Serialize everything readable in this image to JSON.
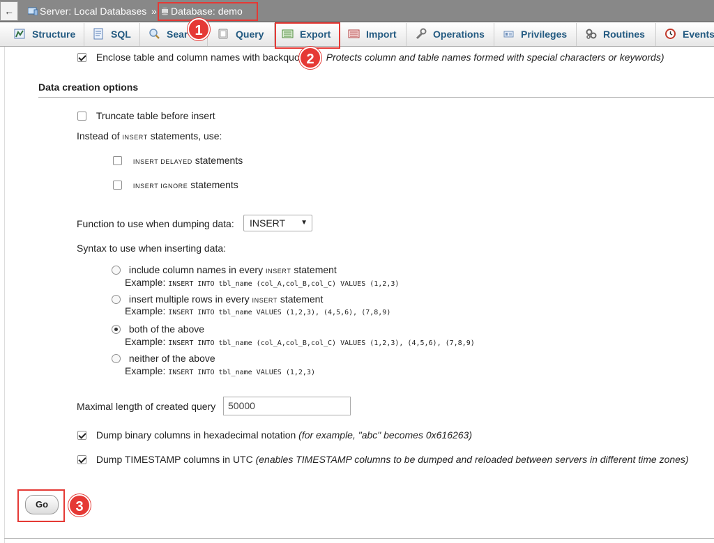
{
  "breadcrumb": {
    "back": "←",
    "server": "Server: Local Databases",
    "separator": "»",
    "database": "Database: demo"
  },
  "tabs": [
    {
      "label": "Structure",
      "icon": "structure-icon"
    },
    {
      "label": "SQL",
      "icon": "sql-icon"
    },
    {
      "label": "Sear",
      "icon": "search-icon"
    },
    {
      "label": "Query",
      "icon": "query-icon"
    },
    {
      "label": "Export",
      "icon": "export-icon"
    },
    {
      "label": "Import",
      "icon": "import-icon"
    },
    {
      "label": "Operations",
      "icon": "wrench-icon"
    },
    {
      "label": "Privileges",
      "icon": "privileges-icon"
    },
    {
      "label": "Routines",
      "icon": "routines-icon"
    },
    {
      "label": "Events",
      "icon": "clock-icon"
    }
  ],
  "enclose": {
    "label": "Enclose table and column names with backquo",
    "note": "Protects column and table names formed with special characters or keywords)"
  },
  "data_creation": {
    "heading": "Data creation options",
    "truncate": "Truncate table before insert",
    "instead_prefix": "Instead of",
    "instead_kw": "INSERT",
    "instead_suffix": "statements, use:",
    "delayed_kw": "INSERT DELAYED",
    "delayed_suffix": "statements",
    "ignore_kw": "INSERT IGNORE",
    "ignore_suffix": "statements",
    "function_label": "Function to use when dumping data:",
    "function_value": "INSERT",
    "syntax_label": "Syntax to use when inserting data:",
    "syntax_options": [
      {
        "pre": "include column names in every",
        "kw": "INSERT",
        "post": "statement",
        "example_label": "Example:",
        "example": "INSERT INTO tbl_name (col_A,col_B,col_C) VALUES (1,2,3)"
      },
      {
        "pre": "insert multiple rows in every",
        "kw": "INSERT",
        "post": "statement",
        "example_label": "Example:",
        "example": "INSERT INTO tbl_name VALUES (1,2,3), (4,5,6), (7,8,9)"
      },
      {
        "pre": "both of the above",
        "kw": "",
        "post": "",
        "example_label": "Example:",
        "example": "INSERT INTO tbl_name (col_A,col_B,col_C) VALUES (1,2,3), (4,5,6), (7,8,9)"
      },
      {
        "pre": "neither of the above",
        "kw": "",
        "post": "",
        "example_label": "Example:",
        "example": "INSERT INTO tbl_name VALUES (1,2,3)"
      }
    ],
    "max_query_label": "Maximal length of created query",
    "max_query_value": "50000",
    "binary_label": "Dump binary columns in hexadecimal notation",
    "binary_note": "(for example, \"abc\" becomes 0x616263)",
    "timestamp_label": "Dump TIMESTAMP columns in UTC",
    "timestamp_note": "(enables TIMESTAMP columns to be dumped and reloaded between servers in different time zones)"
  },
  "go_label": "Go",
  "annotations": {
    "badge1": "1",
    "badge2": "2",
    "badge3": "3",
    "color": "#e53935"
  }
}
